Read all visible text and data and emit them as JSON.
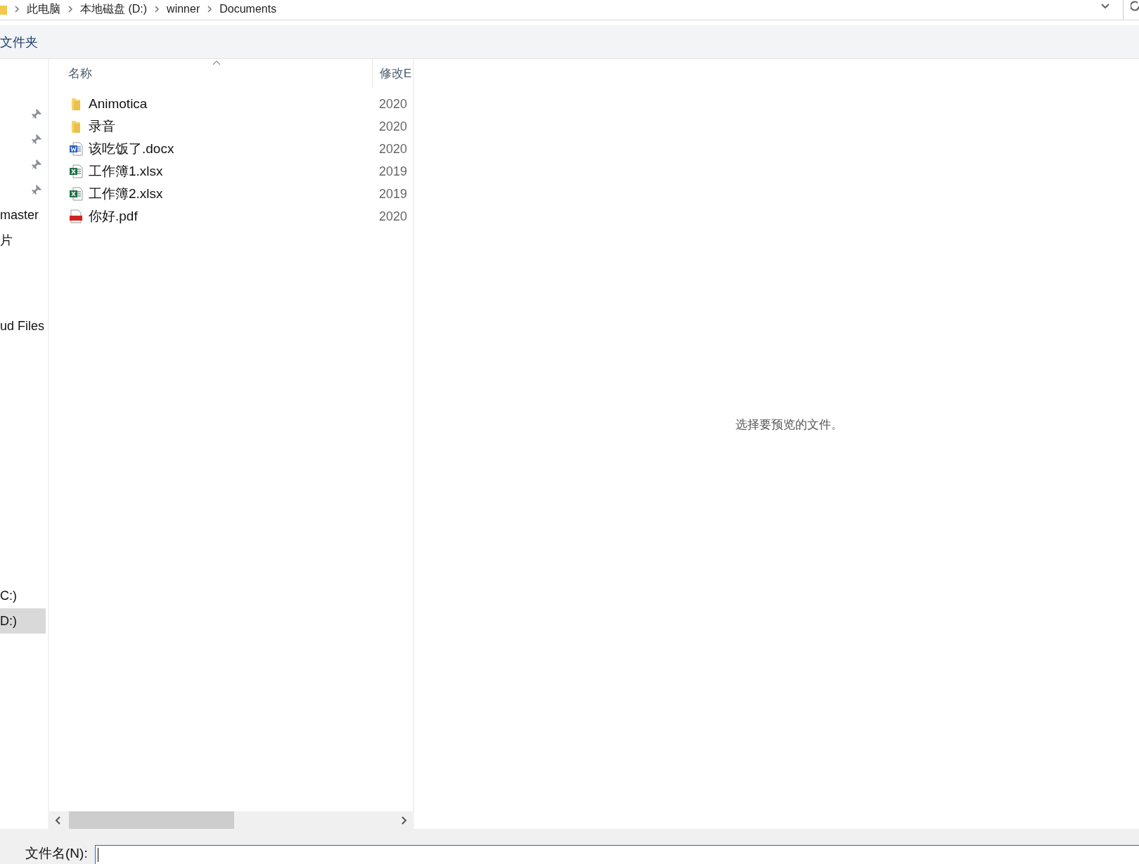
{
  "address_bar": {
    "path": [
      "此电脑",
      "本地磁盘 (D:)",
      "winner",
      "Documents"
    ]
  },
  "toolbar": {
    "label": "文件夹"
  },
  "sidebar": {
    "quick_access": [
      {
        "pinned": true
      },
      {
        "pinned": true
      },
      {
        "pinned": true
      },
      {
        "pinned": true
      }
    ],
    "sections": [
      [
        {
          "label": "master",
          "selected": false
        },
        {
          "label": "片",
          "selected": false
        }
      ],
      [
        {
          "label": "ud Files",
          "selected": false
        }
      ],
      [
        {
          "label": "C:)",
          "selected": false
        },
        {
          "label": "D:)",
          "selected": true
        }
      ]
    ]
  },
  "file_list": {
    "columns": [
      {
        "label": "名称",
        "sorted": true
      },
      {
        "label": "修改E",
        "sorted": false
      }
    ],
    "rows": [
      {
        "kind": "folder",
        "name": "Animotica",
        "modified": "2020"
      },
      {
        "kind": "folder",
        "name": "录音",
        "modified": "2020"
      },
      {
        "kind": "word",
        "name": "该吃饭了.docx",
        "modified": "2020"
      },
      {
        "kind": "excel",
        "name": "工作簿1.xlsx",
        "modified": "2019"
      },
      {
        "kind": "excel",
        "name": "工作簿2.xlsx",
        "modified": "2019"
      },
      {
        "kind": "pdf",
        "name": "你好.pdf",
        "modified": "2020"
      }
    ]
  },
  "preview": {
    "message": "选择要预览的文件。"
  },
  "footer": {
    "filename_label": "文件名(N):"
  }
}
